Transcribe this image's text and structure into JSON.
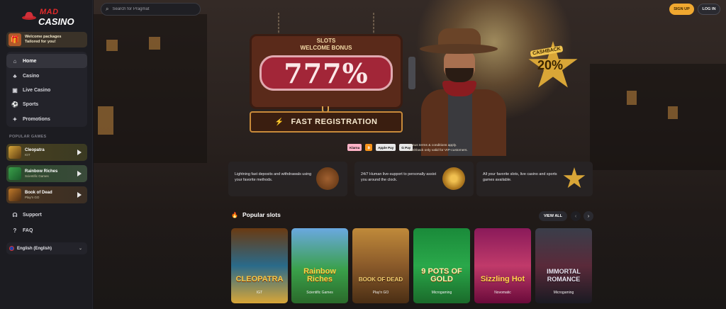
{
  "brand": {
    "logo_top": "MAD",
    "logo_bottom": "CASINO"
  },
  "promo": {
    "line1": "Welcome packages",
    "line2": "Tailored for you!"
  },
  "nav": {
    "items": [
      {
        "label": "Home",
        "icon": "home-icon"
      },
      {
        "label": "Casino",
        "icon": "casino-icon"
      },
      {
        "label": "Live Casino",
        "icon": "live-casino-icon"
      },
      {
        "label": "Sports",
        "icon": "sports-icon"
      },
      {
        "label": "Promotions",
        "icon": "promotions-icon"
      }
    ]
  },
  "popular_games_label": "POPULAR GAMES",
  "sidebar_games": [
    {
      "name": "Cleopatra",
      "provider": "IGT"
    },
    {
      "name": "Rainbow Riches",
      "provider": "Scientific Games"
    },
    {
      "name": "Book of Dead",
      "provider": "Play'n GO"
    }
  ],
  "support": "Support",
  "faq": "FAQ",
  "language": "English (English)",
  "search": {
    "placeholder": "Search for Pragmat"
  },
  "header": {
    "signup": "SIGN UP",
    "login": "LOG IN"
  },
  "hero": {
    "title_line1": "SLOTS",
    "title_line2": "WELCOME BONUS",
    "amount": "777%",
    "cta": "FAST REGISTRATION",
    "cashback_label": "CASHBACK",
    "cashback_value": "20%",
    "payments": [
      "Klarna",
      "₿",
      "Apple Pay",
      "G Pay"
    ],
    "terms_line1": "Bonus terms & conditions apply.",
    "terms_line2": "Cashback only valid for VIP-customers."
  },
  "features": [
    {
      "text": "Lightning fast deposits and withdrawals using your favorite methods."
    },
    {
      "text": "24/7 Human live-support to personally assist you around the clock."
    },
    {
      "text": "All your favorite slots, live casino and sports games available."
    }
  ],
  "popular_slots": {
    "title": "Popular slots",
    "view_all": "VIEW ALL",
    "items": [
      {
        "title": "CLEOPATRA",
        "provider": "IGT"
      },
      {
        "title": "Rainbow Riches",
        "provider": "Scientific Games"
      },
      {
        "title": "BOOK OF DEAD",
        "provider": "Play'n GO"
      },
      {
        "title": "9 POTS OF GOLD",
        "provider": "Microgaming"
      },
      {
        "title": "Sizzling Hot",
        "provider": "Novomatic"
      },
      {
        "title": "IMMORTAL ROMANCE",
        "provider": "Microgaming"
      }
    ]
  },
  "colors": {
    "accent": "#f0a830",
    "bg": "#17171b",
    "sidebar": "#1c1c21"
  }
}
